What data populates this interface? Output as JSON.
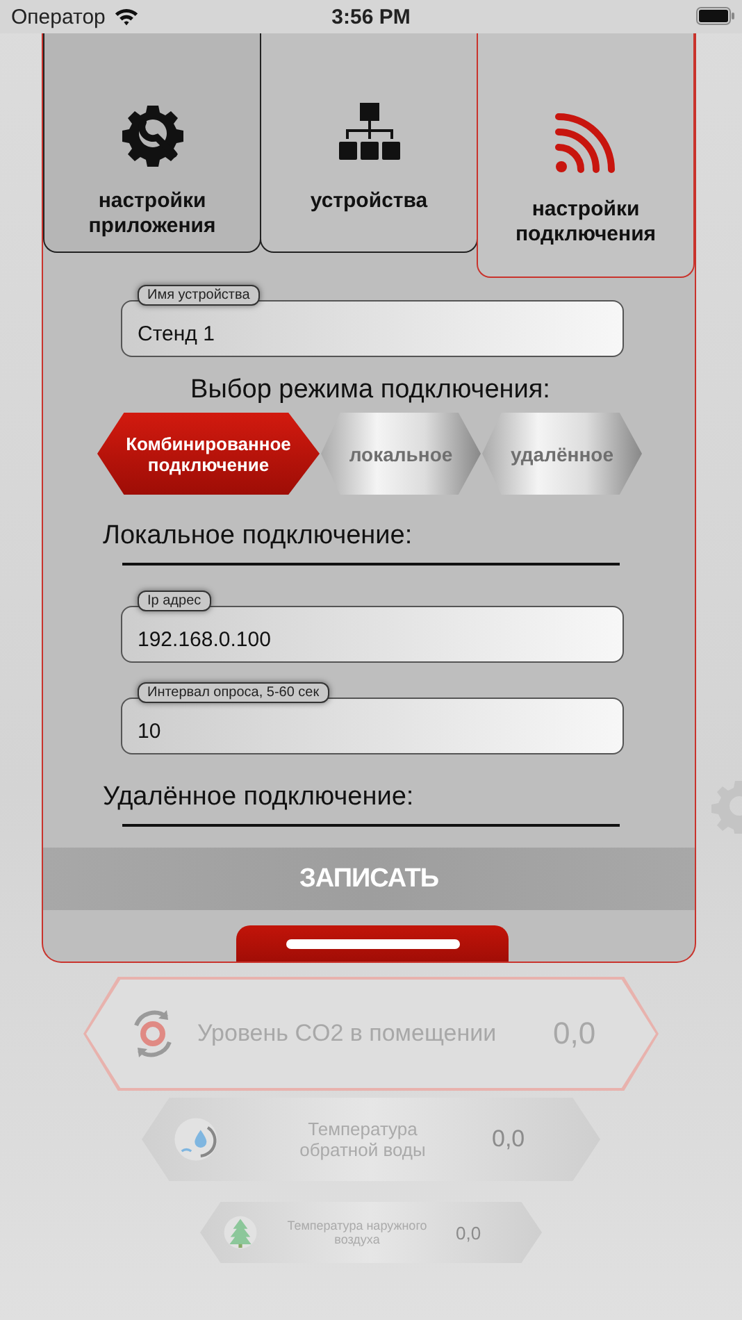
{
  "status_bar": {
    "carrier": "Оператор",
    "time": "3:56 PM"
  },
  "tabs": [
    {
      "kind": "app",
      "label": "настройки приложения",
      "selected": false
    },
    {
      "kind": "devices",
      "label": "устройства",
      "selected": false
    },
    {
      "kind": "connection",
      "label": "настройки подключения",
      "selected": true
    }
  ],
  "device_name_field": {
    "label": "Имя устройства",
    "value": "Стенд 1"
  },
  "mode_heading": "Выбор режима подключения:",
  "modes": [
    {
      "label": "Комбинированное подключение",
      "selected": true
    },
    {
      "label": "локальное",
      "selected": false
    },
    {
      "label": "удалённое",
      "selected": false
    }
  ],
  "local_section": {
    "heading": "Локальное подключение:",
    "fields": [
      {
        "label": "Ip адрес",
        "value": "192.168.0.100"
      },
      {
        "label": "Интервал опроса, 5-60 сек",
        "value": "10"
      }
    ]
  },
  "remote_section": {
    "heading": "Удалённое подключение:"
  },
  "save_button": "ЗАПИСАТЬ",
  "readouts": [
    {
      "kind": "co2",
      "label": "Уровень CO2 в помещении",
      "value": "0,0"
    },
    {
      "kind": "water",
      "label": "Температура обратной воды",
      "value": "0,0"
    },
    {
      "kind": "air",
      "label": "Температура наружного воздуха",
      "value": "0,0"
    }
  ]
}
